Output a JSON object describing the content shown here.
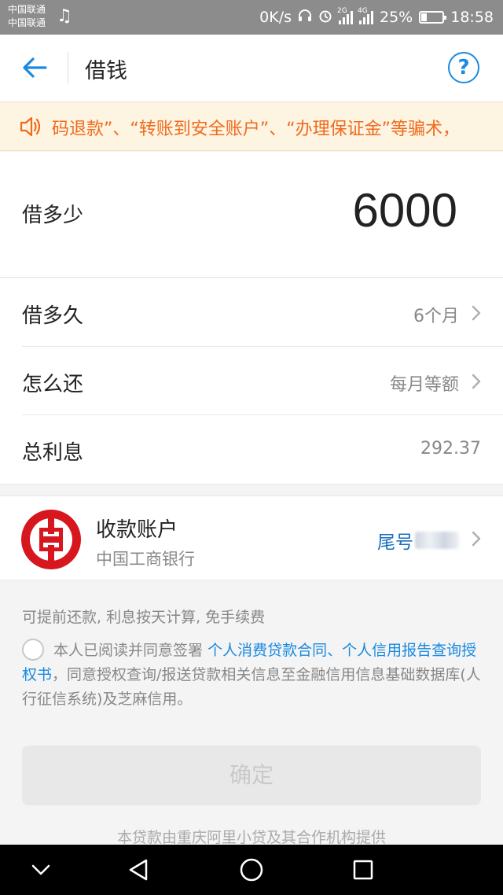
{
  "status_bar": {
    "carrier_1": "中国联通",
    "carrier_2": "中国联通",
    "speed": "0K/s",
    "net_1": "2G",
    "net_2": "4G",
    "battery": "25%",
    "time": "18:58"
  },
  "header": {
    "title": "借钱",
    "help_label": "?"
  },
  "notice": {
    "text": "码退款”、“转账到安全账户”、“办理保证金”等骗术，"
  },
  "amount": {
    "label": "借多少",
    "value": "6000"
  },
  "details": [
    {
      "label": "借多久",
      "value": "6个月"
    },
    {
      "label": "怎么还",
      "value": "每月等额"
    },
    {
      "label": "总利息",
      "value": "292.37"
    }
  ],
  "account": {
    "title": "收款账户",
    "bank": "中国工商银行",
    "tail_label": "尾号"
  },
  "info": {
    "prepay": "可提前还款, 利息按天计算, 免手续费",
    "agree_prefix": "本人已阅读并同意签署",
    "link_contract": "个人消费贷款合同",
    "separator": "、",
    "link_credit": "个人信用报告查询授权书",
    "agree_suffix": "，同意授权查询/报送贷款相关信息至金融信用信息基础数据库(人行征信系统)及芝麻信用。"
  },
  "confirm_label": "确定",
  "footer": "本贷款由重庆阿里小贷及其合作机构提供",
  "colors": {
    "accent": "#1a8ae0",
    "notice_text": "#f06a1c",
    "notice_bg": "#fdf4e2",
    "bank_red": "#d7161e"
  }
}
